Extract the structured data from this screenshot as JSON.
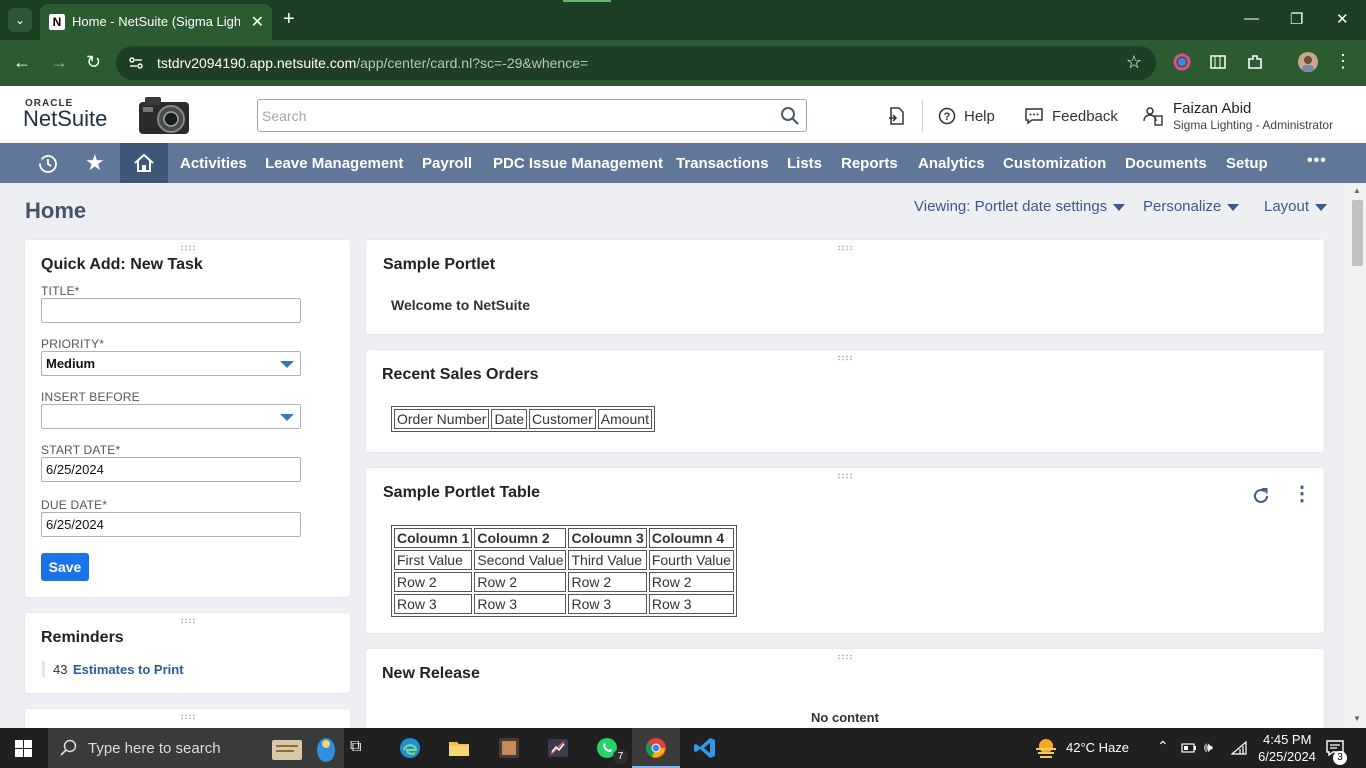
{
  "browser": {
    "tab_title": "Home - NetSuite (Sigma Lighting",
    "favicon_letter": "N",
    "url_host": "tstdrv2094190.app.netsuite.com",
    "url_path": "/app/center/card.nl?sc=-29&whence="
  },
  "header": {
    "brand_top": "ORACLE",
    "brand_main": "NetSuite",
    "search_placeholder": "Search",
    "help_label": "Help",
    "feedback_label": "Feedback",
    "user_name": "Faizan Abid",
    "user_role": "Sigma Lighting - Administrator"
  },
  "nav": {
    "items": [
      "Activities",
      "Leave Management",
      "Payroll",
      "PDC Issue Management",
      "Transactions",
      "Lists",
      "Reports",
      "Analytics",
      "Customization",
      "Documents",
      "Setup"
    ],
    "more": "•••"
  },
  "page": {
    "title": "Home",
    "viewing": "Viewing: Portlet date settings",
    "personalize": "Personalize",
    "layout": "Layout"
  },
  "quick_add": {
    "title": "Quick Add: New Task",
    "title_label": "TITLE*",
    "title_value": "",
    "priority_label": "PRIORITY*",
    "priority_value": "Medium",
    "insert_before_label": "INSERT BEFORE",
    "insert_before_value": "",
    "start_date_label": "START DATE*",
    "start_date_value": "6/25/2024",
    "due_date_label": "DUE DATE*",
    "due_date_value": "6/25/2024",
    "save_label": "Save"
  },
  "reminders": {
    "title": "Reminders",
    "count": "43",
    "label": "Estimates to Print"
  },
  "sample_portlet": {
    "title": "Sample Portlet",
    "text": "Welcome to NetSuite"
  },
  "recent_sales": {
    "title": "Recent Sales Orders",
    "headers": [
      "Order Number",
      "Date",
      "Customer",
      "Amount"
    ]
  },
  "sample_table": {
    "title": "Sample Portlet Table",
    "headers": [
      "Coloumn 1",
      "Coloumn 2",
      "Coloumn 3",
      "Coloumn 4"
    ],
    "rows": [
      [
        "First Value",
        "Second Value",
        "Third Value",
        "Fourth Value"
      ],
      [
        "Row 2",
        "Row 2",
        "Row 2",
        "Row 2"
      ],
      [
        "Row 3",
        "Row 3",
        "Row 3",
        "Row 3"
      ]
    ]
  },
  "new_release": {
    "title": "New Release",
    "no_content": "No content"
  },
  "taskbar": {
    "search_placeholder": "Type here to search",
    "weather": "42°C  Haze",
    "time": "4:45 PM",
    "date": "6/25/2024",
    "whatsapp_badge": "7",
    "notif_badge": "3"
  }
}
